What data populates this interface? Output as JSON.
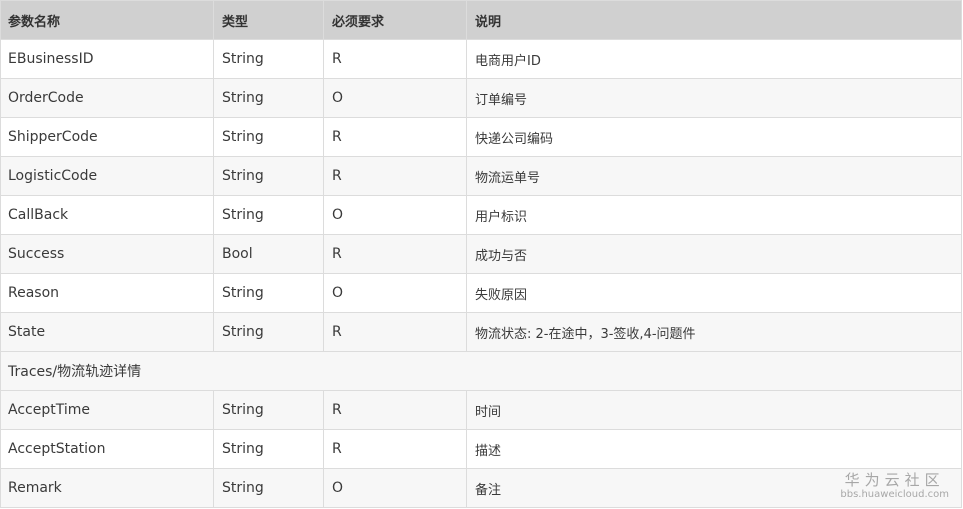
{
  "table": {
    "headers": [
      "参数名称",
      "类型",
      "必须要求",
      "说明"
    ],
    "rows_before_section": [
      {
        "name": "EBusinessID",
        "type": "String",
        "required": "R",
        "desc": "电商用户ID"
      },
      {
        "name": "OrderCode",
        "type": "String",
        "required": "O",
        "desc": "订单编号"
      },
      {
        "name": "ShipperCode",
        "type": "String",
        "required": "R",
        "desc": "快递公司编码"
      },
      {
        "name": "LogisticCode",
        "type": "String",
        "required": "R",
        "desc": "物流运单号"
      },
      {
        "name": "CallBack",
        "type": "String",
        "required": "O",
        "desc": "用户标识"
      },
      {
        "name": "Success",
        "type": "Bool",
        "required": "R",
        "desc": "成功与否"
      },
      {
        "name": "Reason",
        "type": "String",
        "required": "O",
        "desc": "失败原因"
      },
      {
        "name": "State",
        "type": "String",
        "required": "R",
        "desc": "物流状态: 2-在途中，3-签收,4-问题件"
      }
    ],
    "section_label": "Traces/物流轨迹详情",
    "rows_after_section": [
      {
        "name": "AcceptTime",
        "type": "String",
        "required": "R",
        "desc": "时间"
      },
      {
        "name": "AcceptStation",
        "type": "String",
        "required": "R",
        "desc": "描述"
      },
      {
        "name": "Remark",
        "type": "String",
        "required": "O",
        "desc": "备注"
      }
    ]
  },
  "watermark": {
    "title": "华为云社区",
    "url": "bbs.huaweicloud.com"
  }
}
